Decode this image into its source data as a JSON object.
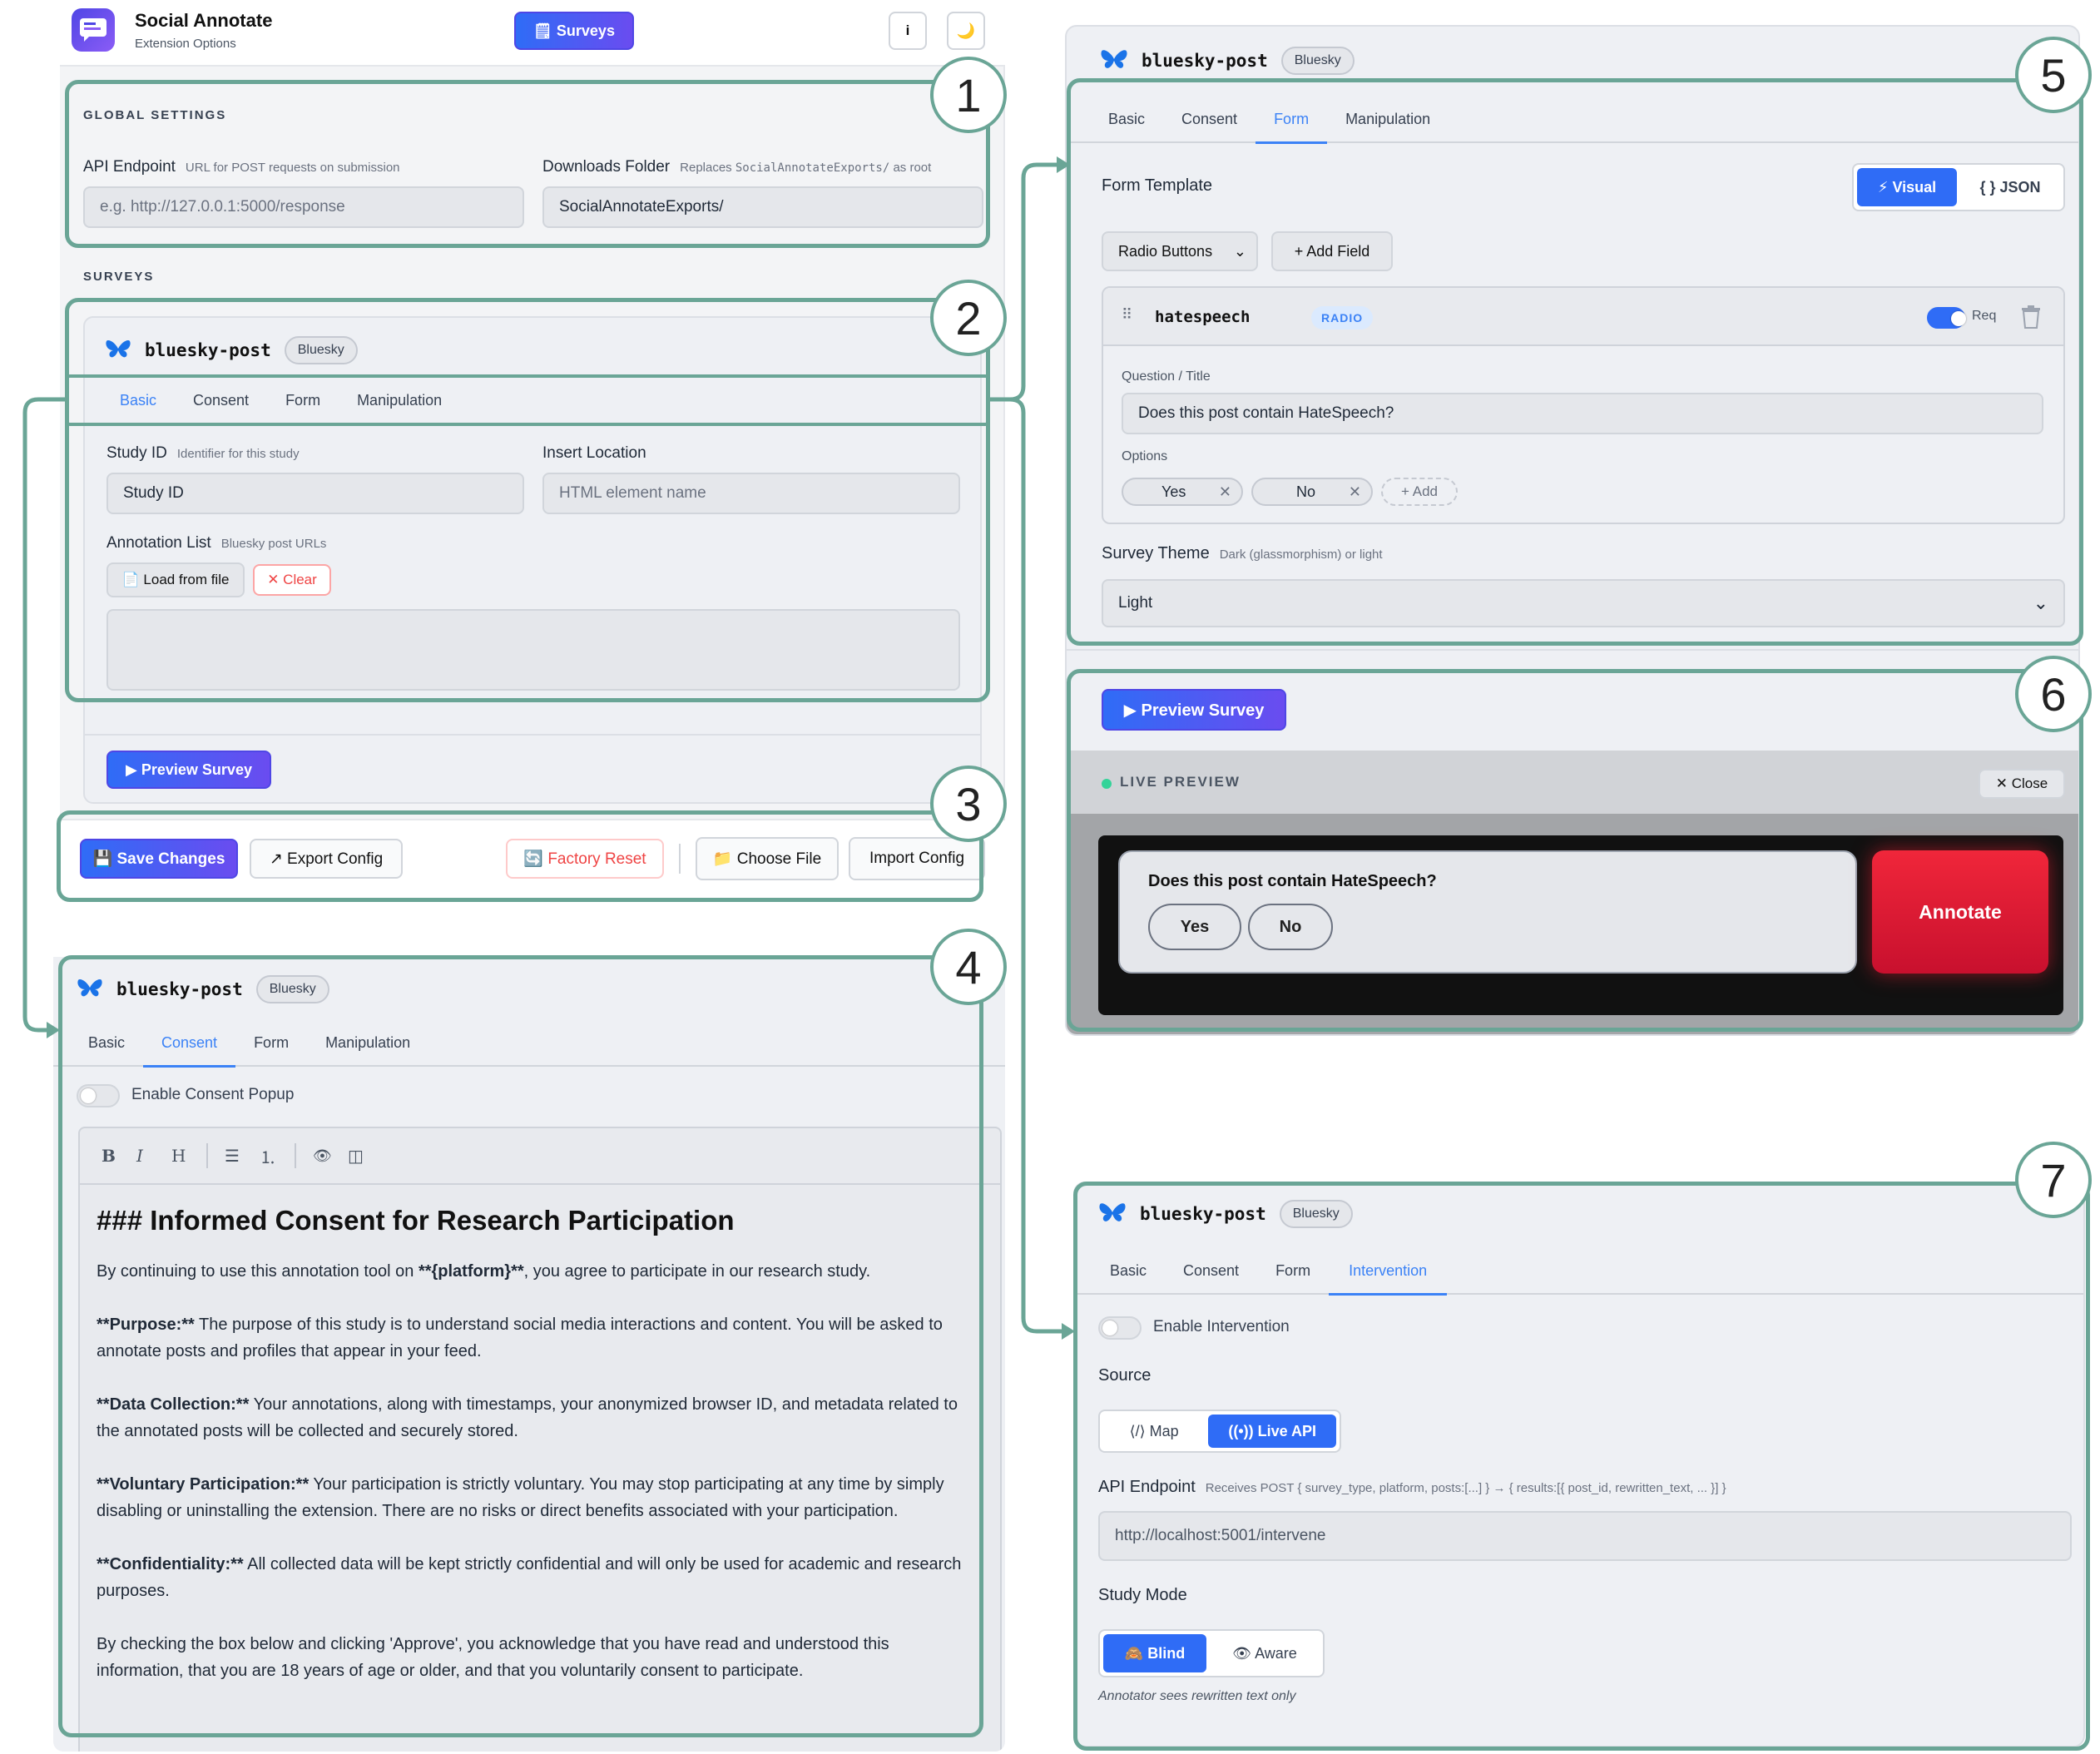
{
  "app": {
    "title": "Social Annotate",
    "subtitle": "Extension Options",
    "surveys_button": "🗒 Surveys",
    "info_button": "i",
    "theme_button": "🌙"
  },
  "global": {
    "section_title": "GLOBAL SETTINGS",
    "api_label": "API Endpoint",
    "api_hint": "URL for POST requests on submission",
    "api_placeholder": "e.g. http://127.0.0.1:5000/response",
    "downloads_label": "Downloads Folder",
    "downloads_hint_pre": "Replaces ",
    "downloads_hint_code": "SocialAnnotateExports/",
    "downloads_hint_post": " as root",
    "downloads_value": "SocialAnnotateExports/"
  },
  "surveys_section_title": "SURVEYS",
  "survey": {
    "name": "bluesky-post",
    "platform": "Bluesky"
  },
  "tabs": {
    "basic": "Basic",
    "consent": "Consent",
    "form": "Form",
    "manipulation": "Manipulation",
    "intervention": "Intervention"
  },
  "basic": {
    "study_id_label": "Study ID",
    "study_id_hint": "Identifier for this study",
    "study_id_value": "Study ID",
    "insert_label": "Insert Location",
    "insert_placeholder": "HTML element name",
    "annotation_label": "Annotation List",
    "annotation_hint": "Bluesky post URLs",
    "load_button": "📄 Load from file",
    "clear_button": "✕ Clear",
    "preview_button": "▶ Preview Survey"
  },
  "footer": {
    "save": "💾 Save Changes",
    "export": "↗ Export Config",
    "reset": "🔄 Factory Reset",
    "choose": "📁 Choose File",
    "import": "Import Config"
  },
  "consent": {
    "toggle_label": "Enable Consent Popup",
    "toolbar": [
      "B",
      "I",
      "H",
      "☰",
      "⒈",
      "👁",
      "◫"
    ],
    "heading": "### Informed Consent for Research Participation",
    "p1_pre": "By continuing to use this annotation tool on ",
    "p1_bold": "**{platform}**",
    "p1_post": ", you agree to participate in our research study.",
    "p2_bold": "**Purpose:**",
    "p2_text": " The purpose of this study is to understand social media interactions and content. You will be asked to annotate posts and profiles that appear in your feed.",
    "p3_bold": "**Data Collection:**",
    "p3_text": " Your annotations, along with timestamps, your anonymized browser ID, and metadata related to the annotated posts will be collected and securely stored.",
    "p4_bold": "**Voluntary Participation:**",
    "p4_text": " Your participation is strictly voluntary. You may stop participating at any time by simply disabling or uninstalling the extension. There are no risks or direct benefits associated with your participation.",
    "p5_bold": "**Confidentiality:**",
    "p5_text": " All collected data will be kept strictly confidential and will only be used for academic and research purposes.",
    "p6": "By checking the box below and clicking 'Approve', you acknowledge that you have read and understood this information, that you are 18 years of age or older, and that you voluntarily consent to participate."
  },
  "form": {
    "template_label": "Form Template",
    "visual": "⚡ Visual",
    "json": "{ } JSON",
    "field_type": "Radio Buttons",
    "add_field": "+ Add Field",
    "field_name": "hatespeech",
    "field_badge": "RADIO",
    "req": "Req",
    "question_label": "Question / Title",
    "question_value": "Does this post contain HateSpeech?",
    "options_label": "Options",
    "options": [
      "Yes",
      "No"
    ],
    "add_option": "+ Add",
    "theme_label": "Survey Theme",
    "theme_hint": "Dark (glassmorphism) or light",
    "theme_value": "Light"
  },
  "preview": {
    "button": "▶ Preview Survey",
    "live_label": "LIVE PREVIEW",
    "close": "✕ Close",
    "question": "Does this post contain HateSpeech?",
    "yes": "Yes",
    "no": "No",
    "annotate": "Annotate"
  },
  "intervention": {
    "toggle_label": "Enable Intervention",
    "source_label": "Source",
    "map": "⟨/⟩ Map",
    "live_api": "((•)) Live API",
    "api_label": "API Endpoint",
    "api_hint": "Receives POST { survey_type, platform, posts:[...] } → { results:[{ post_id, rewritten_text, ... }] }",
    "api_value": "http://localhost:5001/intervene",
    "mode_label": "Study Mode",
    "blind": "🙈 Blind",
    "aware": "👁 Aware",
    "mode_note": "Annotator sees rewritten text only"
  },
  "annotations": [
    "1",
    "2",
    "3",
    "4",
    "5",
    "6",
    "7"
  ],
  "colors": {
    "frame": "#6aa596",
    "accent": "#2f6cf6",
    "annotate": "#e11d2e"
  }
}
